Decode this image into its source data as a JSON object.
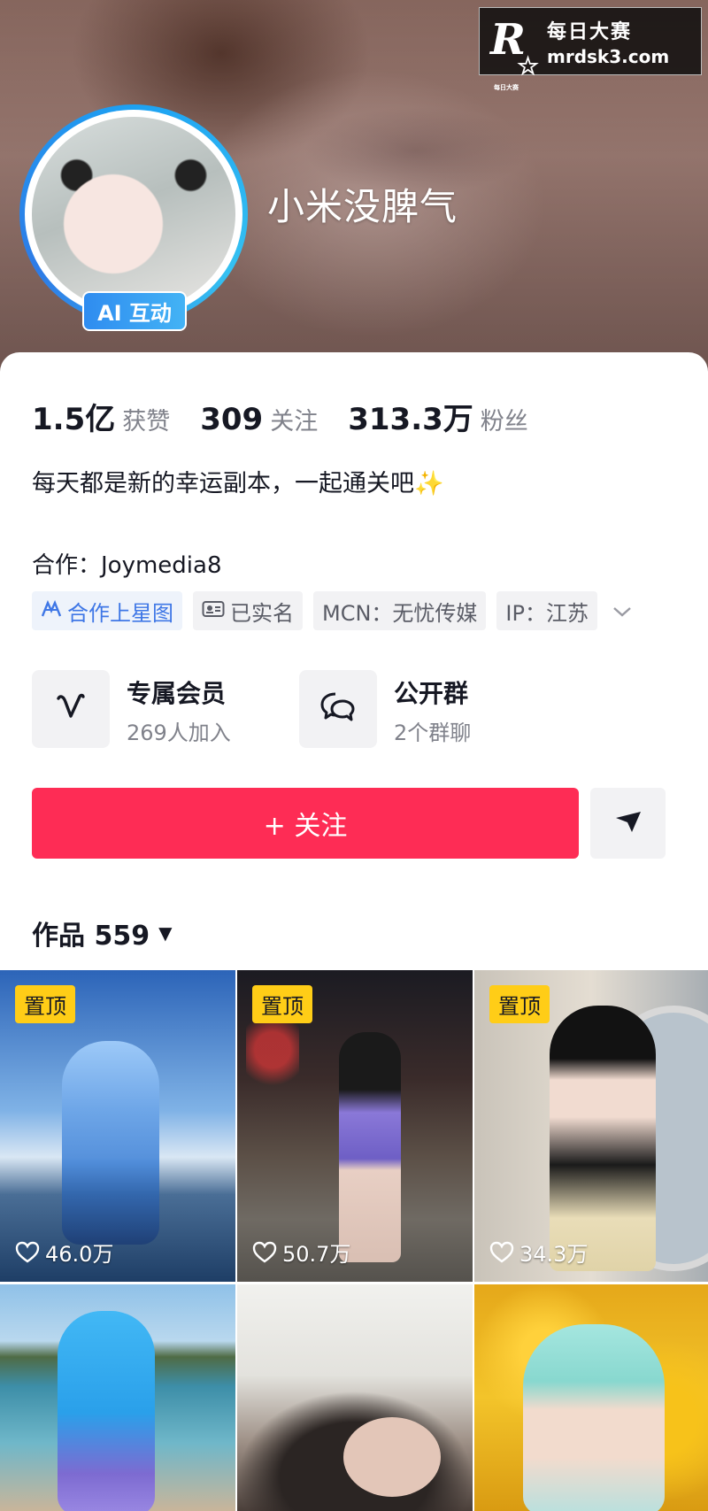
{
  "watermark": {
    "logo_letter": "R",
    "logo_small": "每日大赛",
    "title": "每日大赛",
    "url": "mrdsk3.com"
  },
  "profile": {
    "username": "小米没脾气",
    "ai_badge": "AI 互动"
  },
  "stats": [
    {
      "value": "1.5亿",
      "label": "获赞"
    },
    {
      "value": "309",
      "label": "关注"
    },
    {
      "value": "313.3万",
      "label": "粉丝"
    }
  ],
  "bio": "每天都是新的幸运副本，一起通关吧✨",
  "cooperation": "合作：Joymedia8",
  "tags": [
    {
      "label": "合作上星图",
      "icon": "star-map-icon"
    },
    {
      "label": "已实名",
      "icon": "id-card-icon"
    },
    {
      "label": "MCN：无忧传媒"
    },
    {
      "label": "IP：江苏"
    }
  ],
  "members": [
    {
      "title": "专属会员",
      "subtitle": "269人加入",
      "icon": "v-icon"
    },
    {
      "title": "公开群",
      "subtitle": "2个群聊",
      "icon": "chat-bubbles-icon"
    }
  ],
  "follow_button": "+ 关注",
  "works_label": "作品 559",
  "videos": [
    {
      "pinned": "置顶",
      "likes": "46.0万"
    },
    {
      "pinned": "置顶",
      "likes": "50.7万"
    },
    {
      "pinned": "置顶",
      "likes": "34.3万"
    },
    {},
    {},
    {}
  ],
  "colors": {
    "accent": "#fe2c55",
    "pin_badge": "#ffcd17",
    "ai_badge": "#2f8cf0"
  }
}
